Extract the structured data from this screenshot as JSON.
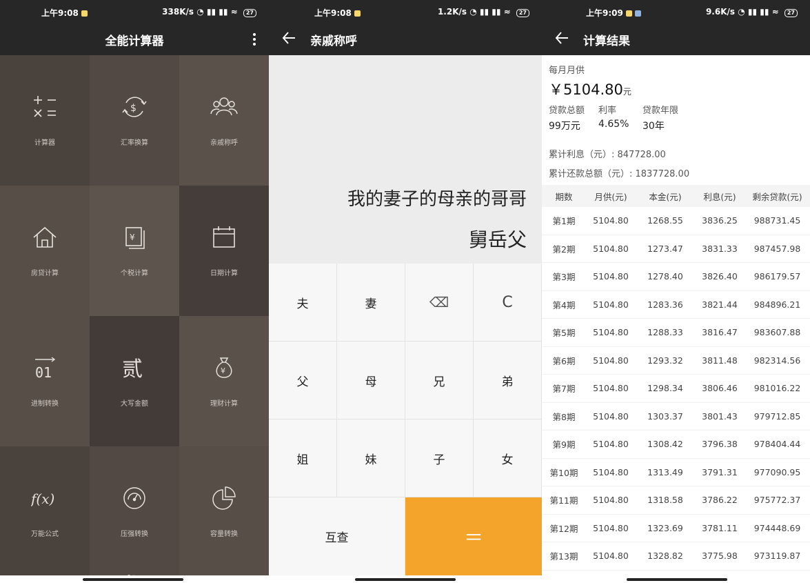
{
  "panel1": {
    "status": {
      "time": "上午9:08",
      "speed": "338K/s",
      "battery": "27"
    },
    "title": "全能计算器",
    "tiles": [
      {
        "label": "计算器",
        "icon": "calculator-icon"
      },
      {
        "label": "汇率换算",
        "icon": "currency-exchange-icon"
      },
      {
        "label": "亲戚称呼",
        "icon": "people-icon"
      },
      {
        "label": "房贷计算",
        "icon": "house-icon"
      },
      {
        "label": "个税计算",
        "icon": "tax-icon"
      },
      {
        "label": "日期计算",
        "icon": "calendar-icon"
      },
      {
        "label": "进制转换",
        "icon": "binary-icon"
      },
      {
        "label": "大写金额",
        "icon": "chinese-numeral-icon"
      },
      {
        "label": "理财计算",
        "icon": "money-bag-icon"
      },
      {
        "label": "万能公式",
        "icon": "function-icon"
      },
      {
        "label": "压强转换",
        "icon": "gauge-icon"
      },
      {
        "label": "容量转换",
        "icon": "pie-icon"
      }
    ],
    "tile_glyphs": {
      "numeral": "贰",
      "binary": "01",
      "yen": "¥",
      "fx": "f(x)"
    }
  },
  "panel2": {
    "status": {
      "time": "上午9:08",
      "speed": "1.2K/s",
      "battery": "27"
    },
    "title": "亲戚称呼",
    "expression": "我的妻子的母亲的哥哥",
    "result": "舅岳父",
    "keys": [
      "夫",
      "妻",
      "⌫",
      "C",
      "父",
      "母",
      "兄",
      "弟",
      "姐",
      "妹",
      "子",
      "女"
    ],
    "swap_label": "互查",
    "equals_label": "＝"
  },
  "panel3": {
    "status": {
      "time": "上午9:09",
      "speed": "9.6K/s",
      "battery": "27"
    },
    "title": "计算结果",
    "monthly_label": "每月月供",
    "monthly_value": "￥5104.80",
    "monthly_unit": "元",
    "loan_total_label": "贷款总额",
    "loan_total_value": "99万元",
    "rate_label": "利率",
    "rate_value": "4.65%",
    "years_label": "贷款年限",
    "years_value": "30年",
    "interest_total": "累计利息（元）: 847728.00",
    "repay_total": "累计还款总额（元）: 1837728.00",
    "columns": [
      "期数",
      "月供(元)",
      "本金(元)",
      "利息(元)",
      "剩余贷款(元)"
    ],
    "rows": [
      [
        "第1期",
        "5104.80",
        "1268.55",
        "3836.25",
        "988731.45"
      ],
      [
        "第2期",
        "5104.80",
        "1273.47",
        "3831.33",
        "987457.98"
      ],
      [
        "第3期",
        "5104.80",
        "1278.40",
        "3826.40",
        "986179.57"
      ],
      [
        "第4期",
        "5104.80",
        "1283.36",
        "3821.44",
        "984896.21"
      ],
      [
        "第5期",
        "5104.80",
        "1288.33",
        "3816.47",
        "983607.88"
      ],
      [
        "第6期",
        "5104.80",
        "1293.32",
        "3811.48",
        "982314.56"
      ],
      [
        "第7期",
        "5104.80",
        "1298.34",
        "3806.46",
        "981016.22"
      ],
      [
        "第8期",
        "5104.80",
        "1303.37",
        "3801.43",
        "979712.85"
      ],
      [
        "第9期",
        "5104.80",
        "1308.42",
        "3796.38",
        "978404.44"
      ],
      [
        "第10期",
        "5104.80",
        "1313.49",
        "3791.31",
        "977090.95"
      ],
      [
        "第11期",
        "5104.80",
        "1318.58",
        "3786.22",
        "975772.37"
      ],
      [
        "第12期",
        "5104.80",
        "1323.69",
        "3781.11",
        "974448.69"
      ],
      [
        "第13期",
        "5104.80",
        "1328.82",
        "3775.98",
        "973119.87"
      ]
    ]
  },
  "colors": {
    "equals_key": "#f4a42a",
    "app_bar": "#272727"
  }
}
